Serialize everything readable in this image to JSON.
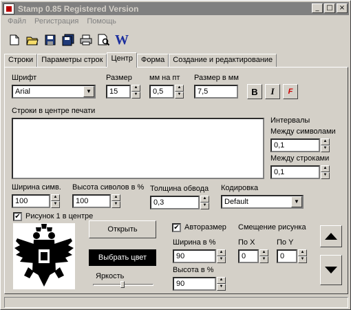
{
  "window": {
    "title": "Stamp 0.85 Registered Version",
    "min": "_",
    "max": "□",
    "close": "×"
  },
  "menu": [
    "Файл",
    "Регистрация",
    "Помощь"
  ],
  "tabs": [
    "Строки",
    "Параметры строк",
    "Центр",
    "Форма",
    "Создание и редактирование"
  ],
  "font": {
    "label": "Шрифт",
    "value": "Arial"
  },
  "size": {
    "label": "Размер",
    "value": "15"
  },
  "mm_per_pt": {
    "label": "мм на пт",
    "value": "0,5"
  },
  "size_mm": {
    "label": "Размер в мм",
    "value": "7,5"
  },
  "format_buttons": {
    "bold": "B",
    "italic": "I",
    "font": "F"
  },
  "center_lines_label": "Строки в центре печати",
  "intervals": {
    "label": "Интервалы",
    "char_label": "Между символами",
    "char_value": "0,1",
    "line_label": "Между строками",
    "line_value": "0,1"
  },
  "char_width": {
    "label": "Ширина симв.",
    "value": "100"
  },
  "char_height": {
    "label": "Высота сиволов в %",
    "value": "100"
  },
  "stroke": {
    "label": "Толщина обвода",
    "value": "0,3"
  },
  "encoding": {
    "label": "Кодировка",
    "value": "Default"
  },
  "picture_check": {
    "label": "Рисунок 1 в центре",
    "checked": true
  },
  "open_button": "Открыть",
  "color_button": "Выбрать цвет",
  "brightness": {
    "label": "Яркость",
    "level": 0.5
  },
  "autosize": {
    "label": "Авторазмер",
    "checked": true
  },
  "offset_label": "Смещение рисунка",
  "pic_width": {
    "label": "Ширина в %",
    "value": "90"
  },
  "pic_height": {
    "label": "Высота в %",
    "value": "90"
  },
  "offset_x": {
    "label": "По X",
    "value": "0"
  },
  "offset_y": {
    "label": "По Y",
    "value": "0"
  },
  "checkmark": "✔",
  "spin_up": "▲",
  "spin_down": "▼",
  "dropdown_arrow": "▼",
  "icons": [
    "new-file-icon",
    "open-folder-icon",
    "save-icon",
    "save-all-icon",
    "print-icon",
    "print-preview-icon",
    "word-export-icon"
  ],
  "word_icon_letter": "W"
}
